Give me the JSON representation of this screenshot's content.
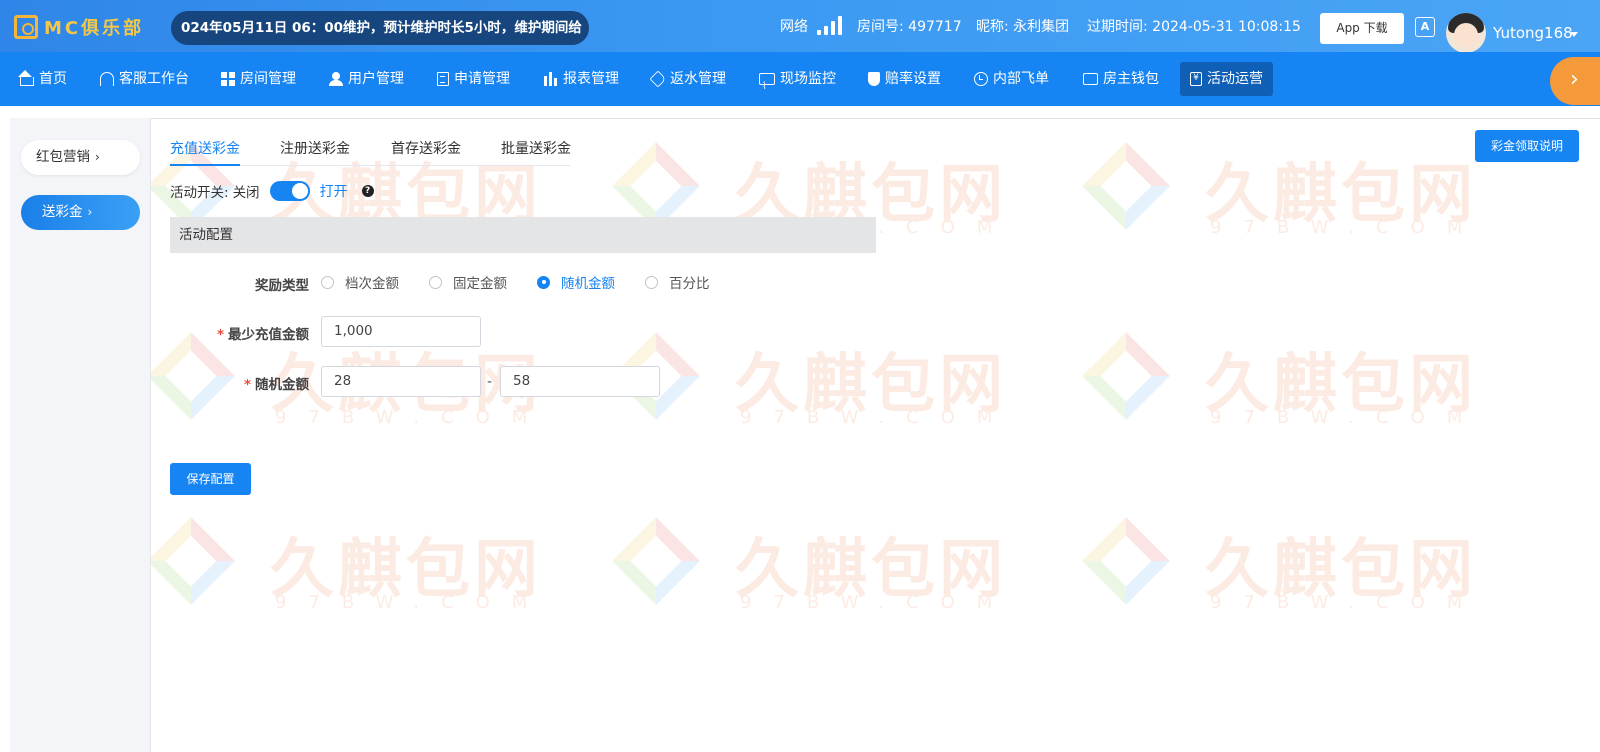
{
  "header": {
    "logo_text": "MC俱乐部",
    "marquee": "024年05月11日 06：00维护，预计维护时长5小时，维护期间给",
    "network_label": "网络",
    "room": "房间号: 497717",
    "nickname": "昵称: 永利集团",
    "expire": "过期时间: 2024-05-31 10:08:15",
    "app_download": "App 下载",
    "lang_icon": "A",
    "username": "Yutong168"
  },
  "nav": {
    "items": [
      {
        "label": "首页",
        "icon": "home-icon"
      },
      {
        "label": "客服工作台",
        "icon": "headset-icon"
      },
      {
        "label": "房间管理",
        "icon": "grid-icon"
      },
      {
        "label": "用户管理",
        "icon": "user-icon"
      },
      {
        "label": "申请管理",
        "icon": "document-icon"
      },
      {
        "label": "报表管理",
        "icon": "bar-chart-icon"
      },
      {
        "label": "返水管理",
        "icon": "tag-icon"
      },
      {
        "label": "现场监控",
        "icon": "monitor-icon"
      },
      {
        "label": "赔率设置",
        "icon": "shield-icon"
      },
      {
        "label": "内部飞单",
        "icon": "clock-icon"
      },
      {
        "label": "房主钱包",
        "icon": "wallet-icon"
      },
      {
        "label": "活动运营",
        "icon": "yen-icon"
      }
    ],
    "active_index": 11,
    "next_arrow": "›"
  },
  "sidebar": {
    "items": [
      {
        "label": "红包营销",
        "chevron": "›"
      },
      {
        "label": "送彩金",
        "chevron": "›"
      }
    ]
  },
  "tabs": [
    "充值送彩金",
    "注册送彩金",
    "首存送彩金",
    "批量送彩金"
  ],
  "help_button": "彩金领取说明",
  "switch": {
    "label": "活动开关:",
    "off_label": "关闭",
    "on_label": "打开",
    "state": true,
    "help": "?"
  },
  "section_title": "活动配置",
  "form": {
    "reward_type_label": "奖励类型",
    "reward_options": [
      "档次金额",
      "固定金额",
      "随机金额",
      "百分比"
    ],
    "reward_selected": "随机金额",
    "min_recharge_label": "最少充值金额",
    "min_recharge_value": "1,000",
    "random_amount_label": "随机金额",
    "random_min": "28",
    "random_max": "58",
    "range_separator": "-",
    "required_mark": "*"
  },
  "save_button": "保存配置",
  "watermark": {
    "text": "久麒包网",
    "sub": "97BW.COM"
  },
  "colors": {
    "primary": "#1684f2",
    "nav_active": "#0f5fb6",
    "accent_orange": "#f59a3a",
    "logo_gold": "#f3c84a"
  }
}
